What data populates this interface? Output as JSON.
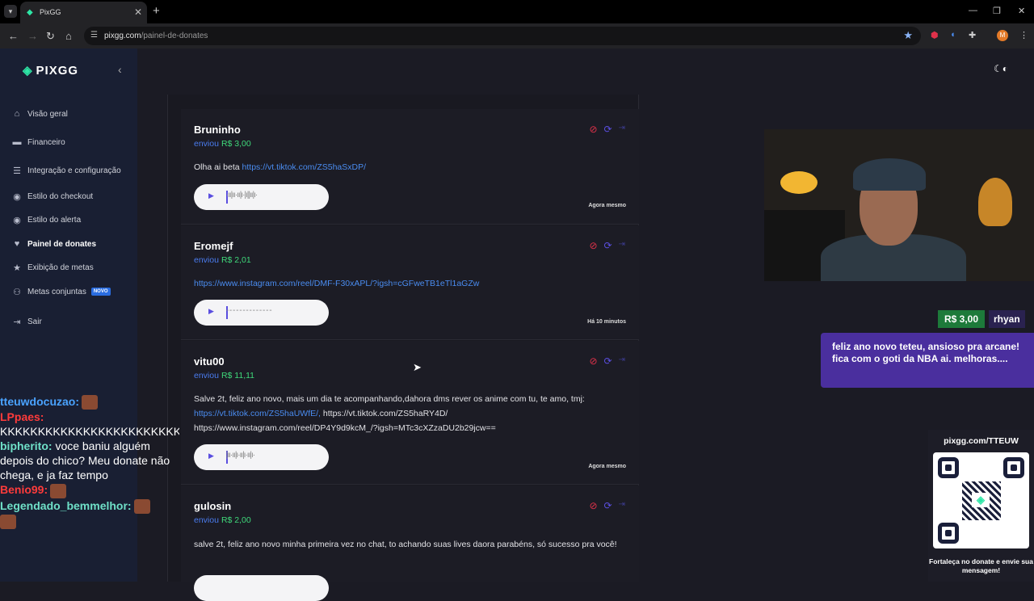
{
  "browser": {
    "tab_title": "PixGG",
    "url_domain": "pixgg.com",
    "url_path": "/painel-de-donates",
    "profile_initial": "M"
  },
  "sidebar": {
    "logo": "PIXGG",
    "items": [
      {
        "label": "Visão geral",
        "icon": "home-icon"
      },
      {
        "label": "Financeiro",
        "icon": "wallet-icon"
      },
      {
        "label": "Integração e configuração",
        "icon": "settings-icon"
      },
      {
        "label": "Estilo do checkout",
        "icon": "palette-icon"
      },
      {
        "label": "Estilo do alerta",
        "icon": "palette-icon"
      },
      {
        "label": "Painel de donates",
        "icon": "donate-icon"
      },
      {
        "label": "Exibição de metas",
        "icon": "star-icon"
      },
      {
        "label": "Metas conjuntas",
        "icon": "goals-icon",
        "badge": "NOVO"
      },
      {
        "label": "Sair",
        "icon": "logout-icon"
      }
    ]
  },
  "donations": [
    {
      "name": "Bruninho",
      "sent_label": "enviou",
      "amount": "R$ 3,00",
      "message_text": "Olha ai beta",
      "message_link": "https://vt.tiktok.com/ZS5haSxDP/",
      "time": "Agora mesmo"
    },
    {
      "name": "Eromejf",
      "sent_label": "enviou",
      "amount": "R$ 2,01",
      "message_link": "https://www.instagram.com/reel/DMF-F30xAPL/?igsh=cGFweTB1eTl1aGZw",
      "time": "Há 10 minutos"
    },
    {
      "name": "vitu00",
      "sent_label": "enviou",
      "amount": "R$ 11,11",
      "message_text": "Salve 2t, feliz ano novo, mais um dia te acompanhando,dahora dms rever os anime com tu, te amo, tmj:",
      "message_link": "https://vt.tiktok.com/ZS5haUWfE/,",
      "message_text2": "https://vt.tiktok.com/ZS5haRY4D/",
      "message_text3": "https://www.instagram.com/reel/DP4Y9d9kcM_/?igsh=MTc3cXZzaDU2b29jcw==",
      "time": "Agora mesmo"
    },
    {
      "name": "gulosin",
      "sent_label": "enviou",
      "amount": "R$ 2,00",
      "message_text": "salve 2t, feliz ano novo minha primeira vez no chat, to achando suas lives daora parabéns, só sucesso pra você!"
    }
  ],
  "overlay": {
    "alert_amount": "R$ 3,00",
    "alert_user": "rhyan",
    "alert_message": "feliz ano novo teteu, ansioso pra arcane! fica com o goti da NBA ai. melhoras....",
    "qr_url": "pixgg.com/TTEUW",
    "qr_caption": "Fortaleça no donate e envie sua mensagem!"
  },
  "chat": [
    {
      "user": "tteuwdocuzao:",
      "text": "",
      "color": "#4aa3ff",
      "emote": true
    },
    {
      "user": "LPpaes:",
      "text": "KKKKKKKKKKKKKKKKKKKKKKKKKKK",
      "color": "#ff3b3b"
    },
    {
      "user": "bipherito:",
      "text": "voce baniu alguém depois do chico? Meu donate não chega, e ja faz tempo",
      "color": "#6fe0c8"
    },
    {
      "user": "Benio99:",
      "text": "",
      "color": "#ff3b3b",
      "emote": true
    },
    {
      "user": "Legendado_bemmelhor:",
      "text": "",
      "color": "#6fe0c8",
      "emote": true
    }
  ],
  "colors": {
    "accent": "#2ee6a6",
    "link": "#4a8cf0",
    "amount": "#3fd87a",
    "ban": "#e0314a"
  }
}
